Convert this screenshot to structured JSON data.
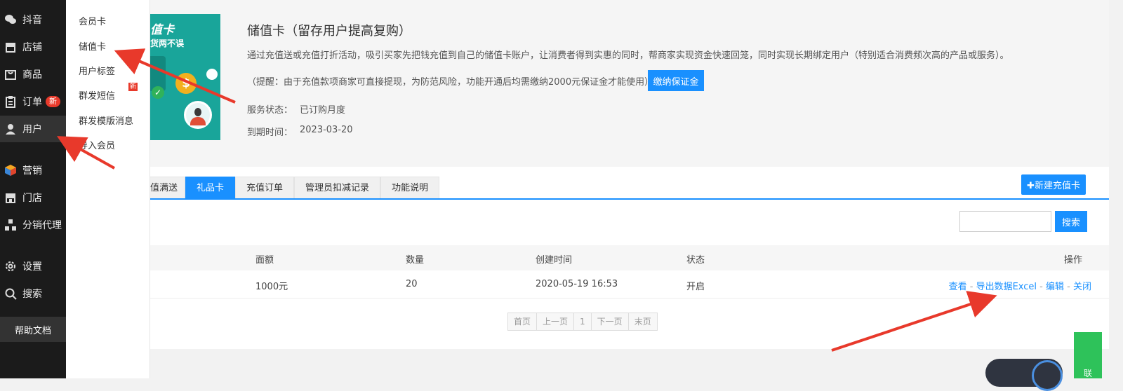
{
  "sidebar": {
    "items": [
      {
        "label": "抖音"
      },
      {
        "label": "店铺"
      },
      {
        "label": "商品"
      },
      {
        "label": "订单",
        "badge": "新"
      },
      {
        "label": "用户"
      },
      {
        "label": "营销"
      },
      {
        "label": "门店"
      },
      {
        "label": "分销代理"
      },
      {
        "label": "设置"
      },
      {
        "label": "搜索"
      }
    ],
    "help": "帮助文档"
  },
  "submenu": {
    "items": [
      "会员卡",
      "储值卡",
      "用户标签",
      "群发短信",
      "群发模版消息",
      "导入会员"
    ],
    "new_badge": "新"
  },
  "promo": {
    "line1": "值卡",
    "line2": "货两不误"
  },
  "header": {
    "title": "储值卡（留存用户提高复购）",
    "desc": "通过充值送或充值打折活动，吸引买家先把钱充值到自己的储值卡账户，让消费者得到实惠的同时，帮商家实现资金快速回笼，同时实现长期绑定用户（特别适合消费频次高的产品或服务）。",
    "tip": "（提醒：由于充值款项商家可直接提现，为防范风险，功能开通后均需缴纳2000元保证金才能使用）",
    "deposit_btn": "缴纳保证金",
    "status_label": "服务状态：",
    "status_value": "已订购月度",
    "expire_label": "到期时间：",
    "expire_value": "2023-03-20"
  },
  "tabs": [
    "值满送",
    "礼品卡",
    "充值订单",
    "管理员扣减记录",
    "功能说明"
  ],
  "new_button": "✚新建充值卡",
  "search_button": "搜索",
  "table": {
    "headers": [
      "面额",
      "数量",
      "创建时间",
      "状态",
      "操作"
    ],
    "rows": [
      {
        "amount": "1000元",
        "count": "20",
        "created": "2020-05-19 16:53",
        "status": "开启"
      }
    ],
    "ops": [
      "查看",
      "导出数据Excel",
      "编辑",
      "关闭"
    ],
    "sep": " - "
  },
  "pager": [
    "首页",
    "上一页",
    "1",
    "下一页",
    "末页"
  ],
  "widget_text": "联",
  "colors": {
    "accent": "#1990ff",
    "sidebar": "#1b1b1b",
    "badge": "#e83a2b",
    "arrow": "#e8392b"
  }
}
